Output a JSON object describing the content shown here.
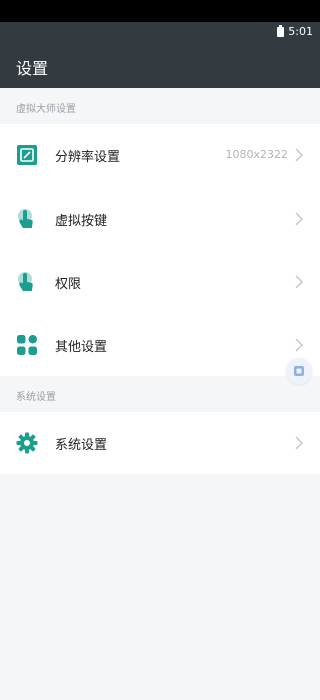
{
  "status_bar": {
    "time": "5:01"
  },
  "header": {
    "title": "设置"
  },
  "sections": [
    {
      "title": "虚拟大师设置",
      "items": [
        {
          "label": "分辨率设置",
          "value": "1080x2322",
          "icon": "resolution-icon"
        },
        {
          "label": "虚拟按键",
          "value": "",
          "icon": "touch-icon"
        },
        {
          "label": "权限",
          "value": "",
          "icon": "touch-icon"
        },
        {
          "label": "其他设置",
          "value": "",
          "icon": "grid-icon"
        }
      ]
    },
    {
      "title": "系统设置",
      "items": [
        {
          "label": "系统设置",
          "value": "",
          "icon": "gear-icon"
        }
      ]
    }
  ],
  "colors": {
    "accent": "#1a9e8f",
    "header_bg": "#333a40"
  }
}
